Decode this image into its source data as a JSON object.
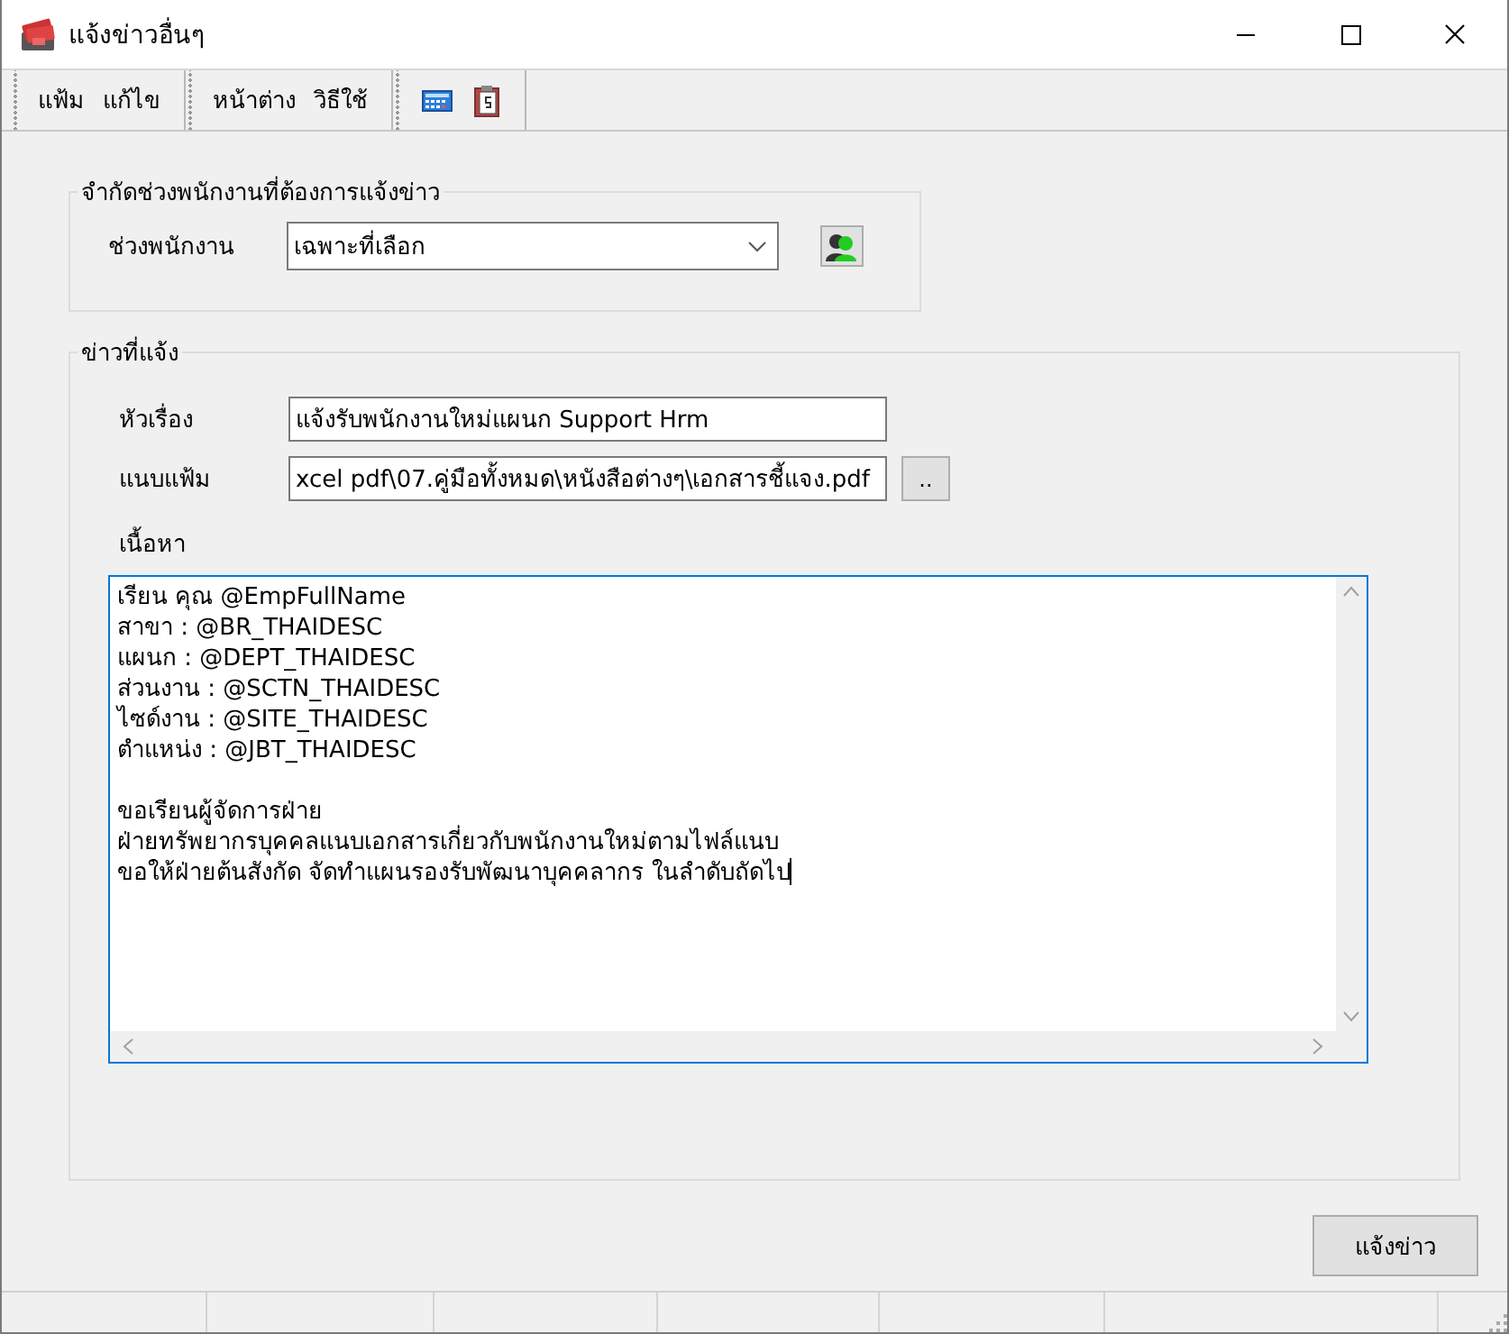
{
  "window": {
    "title": "แจ้งข่าวอื่นๆ"
  },
  "menu": {
    "groups": [
      [
        "แฟ้ม",
        "แก้ไข"
      ],
      [
        "หน้าต่าง",
        "วิธีใช้"
      ]
    ]
  },
  "employee_range": {
    "legend": "จำกัดช่วงพนักงานที่ต้องการแจ้งข่าว",
    "label": "ช่วงพนักงาน",
    "value": "เฉพาะที่เลือก"
  },
  "news": {
    "legend": "ข่าวที่แจ้ง",
    "subject_label": "หัวเรื่อง",
    "subject": "แจ้งรับพนักงานใหม่แผนก Support Hrm",
    "attach_label": "แนบแฟ้ม",
    "attachment": "xcel pdf\\07.คู่มือทั้งหมด\\หนังสือต่างๆ\\เอกสารชี้แจง.pdf",
    "browse_button": "..",
    "content_label": "เนื้อหา",
    "content_focused": true,
    "paragraphs": [
      [
        "เรียน คุณ @EmpFullName",
        "สาขา : @BR_THAIDESC",
        "แผนก : @DEPT_THAIDESC",
        "ส่วนงาน : @SCTN_THAIDESC",
        "ไซด์งาน : @SITE_THAIDESC",
        "ตำแหน่ง : @JBT_THAIDESC"
      ],
      [
        "ขอเรียนผู้จัดการฝ่าย",
        "ฝ่ายทรัพยากรบุคคลแนบเอกสารเกี่ยวกับพนักงานใหม่ตามไฟล์แนบ",
        "ขอให้ฝ่ายต้นสังกัด จัดทำแผนรองรับพัฒนาบุคคลากร ในลำดับถัดไป"
      ]
    ]
  },
  "send_button": "แจ้งข่าว"
}
